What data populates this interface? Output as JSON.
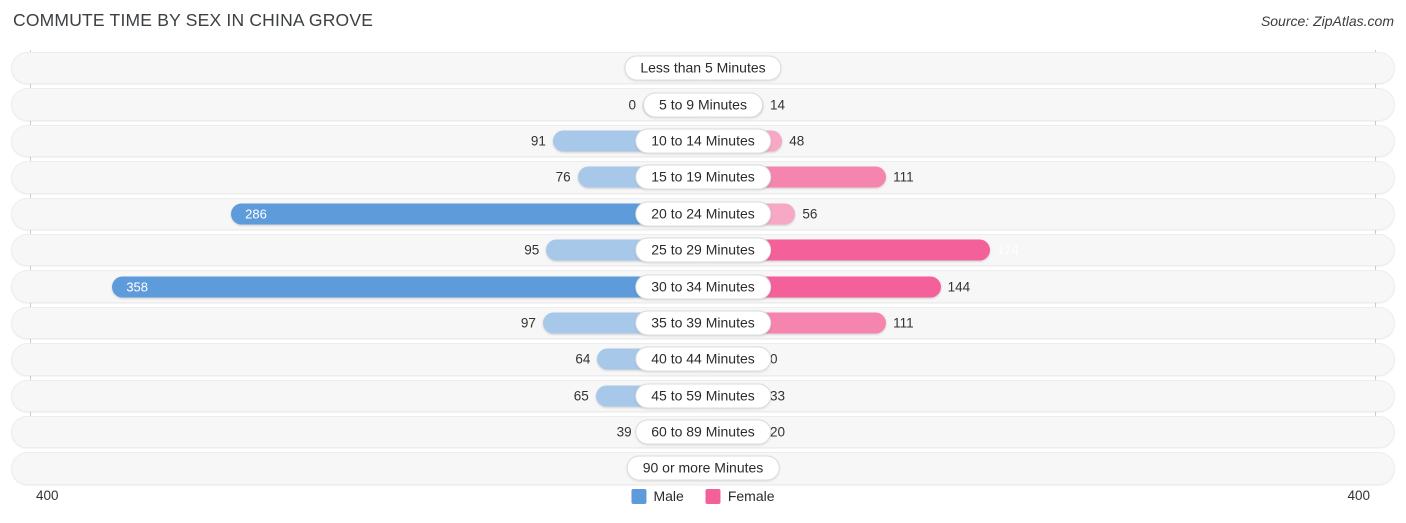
{
  "header": {
    "title": "COMMUTE TIME BY SEX IN CHINA GROVE",
    "source": "Source: ZipAtlas.com"
  },
  "axis": {
    "left_label": "400",
    "right_label": "400"
  },
  "legend": {
    "items": [
      {
        "label": "Male",
        "color": "#5D9BDB"
      },
      {
        "label": "Female",
        "color": "#F4609A"
      }
    ]
  },
  "colors": {
    "male_light": "#A8C8EA",
    "male_dark": "#5D9BDB",
    "female_light": "#F7A8C4",
    "female_mid": "#F585AE",
    "female_dark": "#F4609A",
    "track": "#f7f7f7",
    "text": "#333333"
  },
  "chart_data": {
    "type": "bar",
    "title": "COMMUTE TIME BY SEX IN CHINA GROVE",
    "subtitle": "Source: ZipAtlas.com",
    "orientation": "horizontal-diverging",
    "xlabel": "",
    "ylabel": "",
    "xlim": [
      400,
      400
    ],
    "axis_max": 400,
    "grid": false,
    "legend_position": "bottom-center",
    "categories": [
      "Less than 5 Minutes",
      "5 to 9 Minutes",
      "10 to 14 Minutes",
      "15 to 19 Minutes",
      "20 to 24 Minutes",
      "25 to 29 Minutes",
      "30 to 34 Minutes",
      "35 to 39 Minutes",
      "40 to 44 Minutes",
      "45 to 59 Minutes",
      "60 to 89 Minutes",
      "90 or more Minutes"
    ],
    "series": [
      {
        "name": "Male",
        "color": "#5D9BDB",
        "values": [
          0,
          0,
          91,
          76,
          286,
          95,
          358,
          97,
          64,
          65,
          39,
          0
        ]
      },
      {
        "name": "Female",
        "color": "#F4609A",
        "values": [
          0,
          14,
          48,
          111,
          56,
          174,
          144,
          111,
          0,
          33,
          20,
          0
        ]
      }
    ]
  },
  "rows": [
    {
      "label": "Less than 5 Minutes",
      "male": 0,
      "male_text": "0",
      "female": 0,
      "female_text": "0"
    },
    {
      "label": "5 to 9 Minutes",
      "male": 0,
      "male_text": "0",
      "female": 14,
      "female_text": "14"
    },
    {
      "label": "10 to 14 Minutes",
      "male": 91,
      "male_text": "91",
      "female": 48,
      "female_text": "48"
    },
    {
      "label": "15 to 19 Minutes",
      "male": 76,
      "male_text": "76",
      "female": 111,
      "female_text": "111"
    },
    {
      "label": "20 to 24 Minutes",
      "male": 286,
      "male_text": "286",
      "female": 56,
      "female_text": "56"
    },
    {
      "label": "25 to 29 Minutes",
      "male": 95,
      "male_text": "95",
      "female": 174,
      "female_text": "174"
    },
    {
      "label": "30 to 34 Minutes",
      "male": 358,
      "male_text": "358",
      "female": 144,
      "female_text": "144"
    },
    {
      "label": "35 to 39 Minutes",
      "male": 97,
      "male_text": "97",
      "female": 111,
      "female_text": "111"
    },
    {
      "label": "40 to 44 Minutes",
      "male": 64,
      "male_text": "64",
      "female": 0,
      "female_text": "0"
    },
    {
      "label": "45 to 59 Minutes",
      "male": 65,
      "male_text": "65",
      "female": 33,
      "female_text": "33"
    },
    {
      "label": "60 to 89 Minutes",
      "male": 39,
      "male_text": "39",
      "female": 20,
      "female_text": "20"
    },
    {
      "label": "90 or more Minutes",
      "male": 0,
      "male_text": "0",
      "female": 0,
      "female_text": "0"
    }
  ]
}
